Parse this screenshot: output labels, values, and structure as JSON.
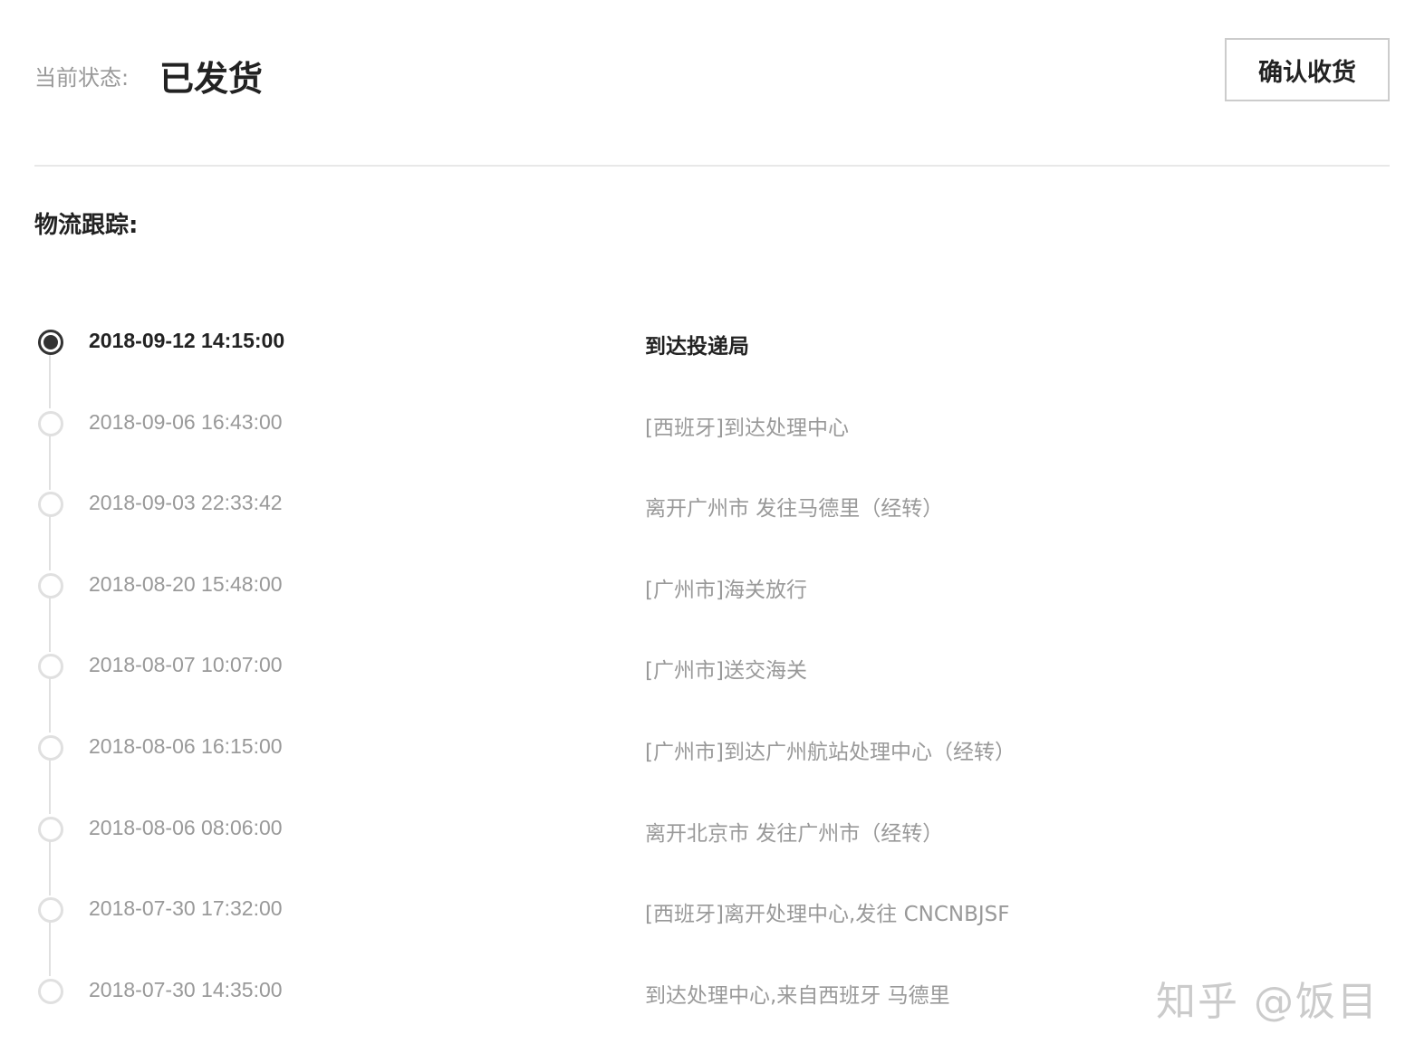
{
  "header": {
    "status_label": "当前状态:",
    "status_value": "已发货",
    "confirm_button_label": "确认收货"
  },
  "logistics": {
    "title": "物流跟踪:",
    "events": [
      {
        "time": "2018-09-12 14:15:00",
        "desc": "到达投递局",
        "current": true
      },
      {
        "time": "2018-09-06 16:43:00",
        "desc": "[西班牙]到达处理中心",
        "current": false
      },
      {
        "time": "2018-09-03 22:33:42",
        "desc": "离开广州市 发往马德里（经转）",
        "current": false
      },
      {
        "time": "2018-08-20 15:48:00",
        "desc": "[广州市]海关放行",
        "current": false
      },
      {
        "time": "2018-08-07 10:07:00",
        "desc": "[广州市]送交海关",
        "current": false
      },
      {
        "time": "2018-08-06 16:15:00",
        "desc": "[广州市]到达广州航站处理中心（经转）",
        "current": false
      },
      {
        "time": "2018-08-06 08:06:00",
        "desc": "离开北京市 发往广州市（经转）",
        "current": false
      },
      {
        "time": "2018-07-30 17:32:00",
        "desc": "[西班牙]离开处理中心,发往 CNCNBJSF",
        "current": false
      },
      {
        "time": "2018-07-30 14:35:00",
        "desc": "到达处理中心,来自西班牙 马德里",
        "current": false
      }
    ]
  },
  "watermark": "知乎 @饭目",
  "colors": {
    "text_dark": "#222222",
    "text_muted": "#999999",
    "line": "#e0e0e0",
    "border": "#cccccc"
  }
}
